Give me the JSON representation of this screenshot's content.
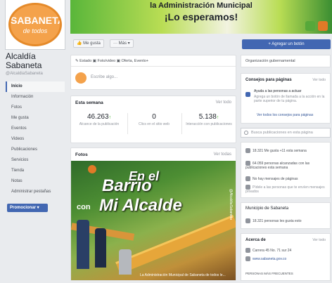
{
  "cover": {
    "line1": "la Administración Municipal",
    "line2": "¡Lo esperamos!"
  },
  "profile": {
    "logo_text": "SABANETA",
    "logo_sub": "de todos",
    "name": "Alcaldía Sabaneta",
    "handle": "@AlcaldiaSabaneta"
  },
  "nav": {
    "items": [
      {
        "label": "Inicio",
        "active": true
      },
      {
        "label": "Información"
      },
      {
        "label": "Fotos"
      },
      {
        "label": "Me gusta"
      },
      {
        "label": "Eventos"
      },
      {
        "label": "Videos"
      },
      {
        "label": "Publicaciones"
      },
      {
        "label": "Servicios"
      },
      {
        "label": "Tienda"
      },
      {
        "label": "Notas"
      },
      {
        "label": "Administrar pestañas"
      }
    ],
    "promote_label": "Promocionar ▾"
  },
  "action_bar": {
    "like_label": "👍 Me gusta",
    "more_label": "··· Más ▾",
    "cta_label": "+ Agregar un botón"
  },
  "composer": {
    "tabs": "✎ Estado  ▣ Foto/video  ▣ Oferta, Evento+",
    "placeholder": "Escribe algo..."
  },
  "stats": {
    "header": "Esta semana",
    "see_all": "Ver todo",
    "items": [
      {
        "num": "46.263",
        "label": "Alcance de la publicación"
      },
      {
        "num": "0",
        "label": "Clics en el sitio web"
      },
      {
        "num": "5.138",
        "label": "Interacción con publicaciones"
      }
    ]
  },
  "posts": {
    "header": "Fotos",
    "see_all": "Ver todas",
    "img_en_el": "En el",
    "img_barrio": "Barrio",
    "img_con": "con",
    "img_mi_alcalde": "Mi Alcalde",
    "img_caption": "La Administración Municipal de Sabaneta de todos le...",
    "img_side": "@AlcaldiaSabaneta"
  },
  "right": {
    "org_label": "Organización gubernamental",
    "tips_header": "Consejos para páginas",
    "tips_see_all": "Ver todo",
    "tip_title": "Ayuda a las personas a actuar",
    "tip_body": "Agrega un botón de llamada a la acción en la parte superior de tu página.",
    "tips_link": "Ver todos los consejos para páginas",
    "search_placeholder": "Busca publicaciones en esta página",
    "likes_row": "18.321 Me gusta +11 esta semana",
    "responses_row": "64.059 personas alcanzadas con las publicaciones esta semana",
    "messages_row": "No hay mensajes de páginas",
    "reply_row": "Pídele a las personas que te envíen mensajes privados",
    "municipio_header": "Municipio de Sabaneta",
    "municipio_likes": "18.321 personas les gusta esto",
    "about_header": "Acerca de",
    "about_see_all": "Ver todo",
    "address": "Carrera 45 No. 71 sur 24",
    "website": "www.sabaneta.gov.co",
    "people_header": "PERSONAS MÁS FRECUENTES"
  }
}
